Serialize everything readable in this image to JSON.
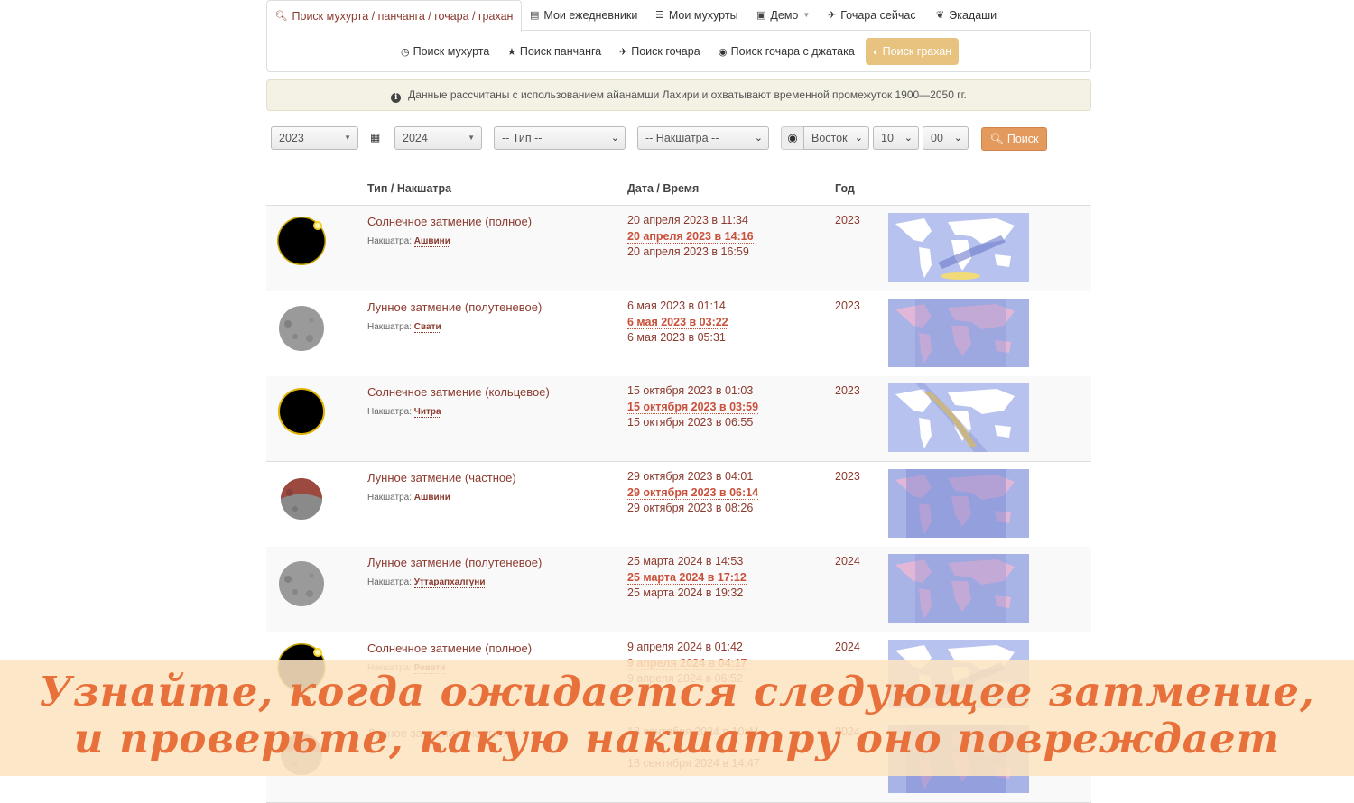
{
  "tabs": [
    {
      "label": "Поиск мухурта / панчанга / гочара / грахан",
      "icon": "search-icon",
      "active": true
    },
    {
      "label": "Мои ежедневники",
      "icon": "notebook-icon"
    },
    {
      "label": "Мои мухурты",
      "icon": "list-icon"
    },
    {
      "label": "Демо",
      "icon": "camera-icon",
      "dropdown": true
    },
    {
      "label": "Гочара сейчас",
      "icon": "plane-icon"
    },
    {
      "label": "Экадаши",
      "icon": "leaf-icon"
    }
  ],
  "subnav": [
    {
      "label": "Поиск мухурта",
      "icon": "clock-icon"
    },
    {
      "label": "Поиск панчанга",
      "icon": "star-icon"
    },
    {
      "label": "Поиск гочара",
      "icon": "plane-icon"
    },
    {
      "label": "Поиск гочара с джатака",
      "icon": "globe-icon"
    },
    {
      "label": "Поиск грахан",
      "icon": "half-circle-icon",
      "active": true
    }
  ],
  "info": {
    "text": "Данные рассчитаны с использованием айанамши Лахири и охватывают временной промежуток 1900—2050 гг."
  },
  "filters": {
    "year_from": "2023",
    "year_to": "2024",
    "type_placeholder": "-- Тип --",
    "nakshatra_placeholder": "-- Накшатра --",
    "timezone": "Восток",
    "hour": "10",
    "minute": "00",
    "search_label": "Поиск"
  },
  "table": {
    "headers": {
      "type": "Тип / Накшатра",
      "date": "Дата / Время",
      "year": "Год"
    },
    "nakshatra_label": "Накшатра:",
    "rows": [
      {
        "kind": "solar-total",
        "type": "Солнечное затмение (полное)",
        "nakshatra": "Ашвини",
        "start": "20 апреля 2023 в 11:34",
        "peak": "20 апреля 2023 в 14:16",
        "end": "20 апреля 2023 в 16:59",
        "year": "2023"
      },
      {
        "kind": "lunar-penumbral",
        "type": "Лунное затмение (полутеневое)",
        "nakshatra": "Свати",
        "start": "6 мая 2023 в 01:14",
        "peak": "6 мая 2023 в 03:22",
        "end": "6 мая 2023 в 05:31",
        "year": "2023"
      },
      {
        "kind": "solar-annular",
        "type": "Солнечное затмение (кольцевое)",
        "nakshatra": "Читра",
        "start": "15 октября 2023 в 01:03",
        "peak": "15 октября 2023 в 03:59",
        "end": "15 октября 2023 в 06:55",
        "year": "2023"
      },
      {
        "kind": "lunar-partial",
        "type": "Лунное затмение (частное)",
        "nakshatra": "Ашвини",
        "start": "29 октября 2023 в 04:01",
        "peak": "29 октября 2023 в 06:14",
        "end": "29 октября 2023 в 08:26",
        "year": "2023"
      },
      {
        "kind": "lunar-penumbral",
        "type": "Лунное затмение (полутеневое)",
        "nakshatra": "Уттарапхалгуни",
        "start": "25 марта 2024 в 14:53",
        "peak": "25 марта 2024 в 17:12",
        "end": "25 марта 2024 в 19:32",
        "year": "2024"
      },
      {
        "kind": "solar-total",
        "type": "Солнечное затмение (полное)",
        "nakshatra": "Ревати",
        "start": "9 апреля 2024 в 01:42",
        "peak": "9 апреля 2024 в 04:17",
        "end": "9 апреля 2024 в 06:52",
        "year": "2024"
      },
      {
        "kind": "lunar-partial",
        "type": "Лунное затмение (частное)",
        "nakshatra": "",
        "start": "18 сентября 2024 в 10:41",
        "peak": "",
        "end": "18 сентября 2024 в 14:47",
        "year": "2024"
      }
    ]
  },
  "banner": {
    "line1": "Узнайте, когда ожидается следующее затмение,",
    "line2": "и проверьте, какую накшатру оно повреждает"
  },
  "colors": {
    "accent": "#8b3a2e",
    "peak": "#c9503a",
    "pill_active": "#e8c27f",
    "search_button": "#e39a5c",
    "banner_text": "#e8703a"
  }
}
